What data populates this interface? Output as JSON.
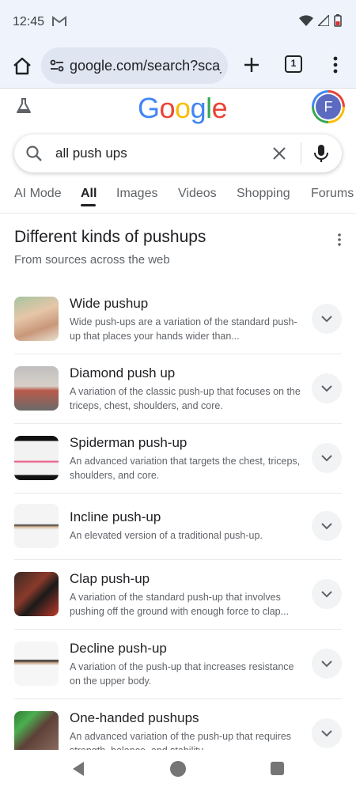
{
  "status": {
    "time": "12:45"
  },
  "browser": {
    "url": "google.com/search?sca_",
    "tab_count": "1"
  },
  "google": {
    "logo_letters": [
      "G",
      "o",
      "o",
      "g",
      "l",
      "e"
    ],
    "avatar_letter": "F"
  },
  "search": {
    "query": "all push ups"
  },
  "tabs": [
    {
      "label": "AI Mode",
      "active": false
    },
    {
      "label": "All",
      "active": true
    },
    {
      "label": "Images",
      "active": false
    },
    {
      "label": "Videos",
      "active": false
    },
    {
      "label": "Shopping",
      "active": false
    },
    {
      "label": "Forums",
      "active": false
    }
  ],
  "section": {
    "title": "Different kinds of pushups",
    "subtitle": "From sources across the web"
  },
  "items": [
    {
      "title": "Wide pushup",
      "desc": "Wide push-ups are a variation of the standard push-up that places your hands wider than..."
    },
    {
      "title": "Diamond push up",
      "desc": "A variation of the classic push-up that focuses on the triceps, chest, shoulders, and core."
    },
    {
      "title": "Spiderman push-up",
      "desc": "An advanced variation that targets the chest, triceps, shoulders, and core."
    },
    {
      "title": "Incline push-up",
      "desc": "An elevated version of a traditional push-up."
    },
    {
      "title": "Clap push-up",
      "desc": "A variation of the standard push-up that involves pushing off the ground with enough force to clap..."
    },
    {
      "title": "Decline push-up",
      "desc": "A variation of the push-up that increases resistance on the upper body."
    },
    {
      "title": "One-handed pushups",
      "desc": "An advanced variation of the push-up that requires strength, balance, and stability."
    }
  ]
}
